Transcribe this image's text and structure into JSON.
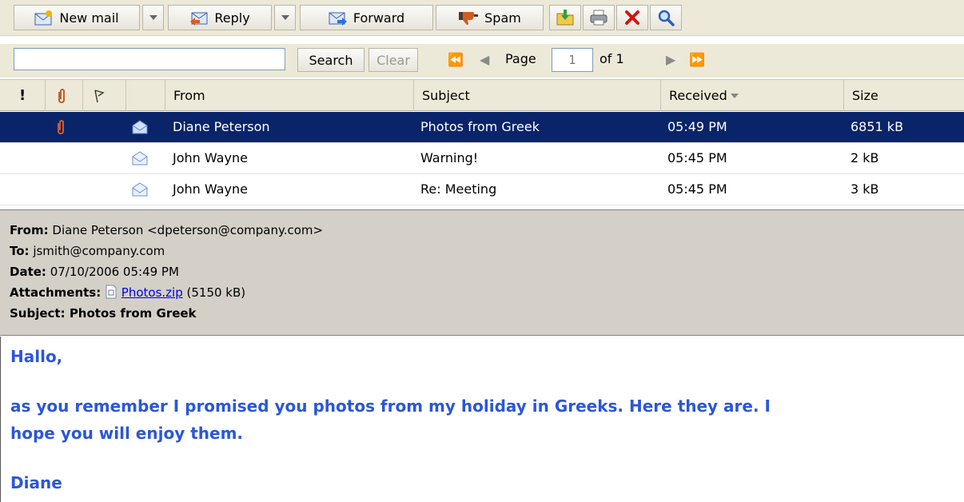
{
  "toolbar": {
    "new_mail": "New mail",
    "reply": "Reply",
    "forward": "Forward",
    "spam": "Spam"
  },
  "search": {
    "value": "",
    "search_label": "Search",
    "clear_label": "Clear"
  },
  "pager": {
    "page_label": "Page",
    "page_value": "1",
    "of_label": "of 1"
  },
  "columns": {
    "from": "From",
    "subject": "Subject",
    "received": "Received",
    "size": "Size"
  },
  "messages": [
    {
      "from": "Diane Peterson",
      "subject": "Photos from Greek",
      "received": "05:49 PM",
      "size": "6851 kB",
      "selected": true,
      "attachment": true
    },
    {
      "from": "John Wayne",
      "subject": "Warning!",
      "received": "05:45 PM",
      "size": "2 kB",
      "selected": false,
      "attachment": false
    },
    {
      "from": "John Wayne",
      "subject": "Re: Meeting",
      "received": "05:45 PM",
      "size": "3 kB",
      "selected": false,
      "attachment": false
    }
  ],
  "preview": {
    "from_label": "From:",
    "from_value": "Diane Peterson <dpeterson@company.com>",
    "to_label": "To:",
    "to_value": "jsmith@company.com",
    "date_label": "Date:",
    "date_value": "07/10/2006 05:49 PM",
    "attachments_label": "Attachments:",
    "attachment_name": "Photos.zip",
    "attachment_size": "(5150 kB)",
    "subject_line": "Subject: Photos from Greek",
    "body": {
      "greeting": "Hallo,",
      "paragraph": "as you remember I promised you photos from my holiday in Greeks. Here they are. I hope you will enjoy them.",
      "signature": "Diane"
    }
  },
  "colors": {
    "selected_row": "#0a246a",
    "body_text": "#2a57d9",
    "toolbar_bg": "#ece9d8"
  }
}
